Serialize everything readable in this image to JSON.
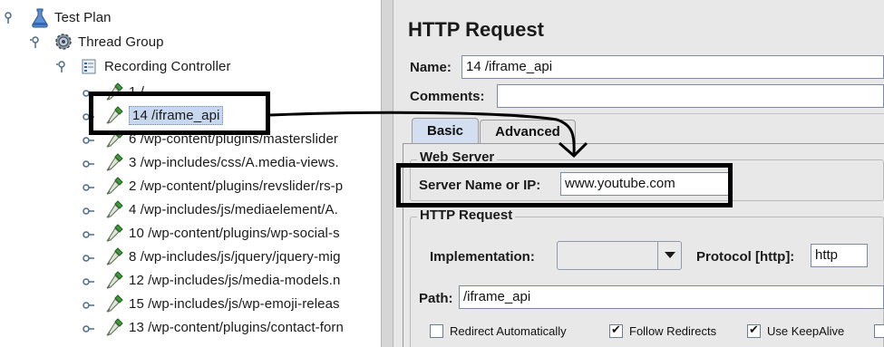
{
  "tree": {
    "test_plan": "Test Plan",
    "thread_group": "Thread Group",
    "recording_controller": "Recording Controller",
    "samplers": [
      "1 /",
      "14 /iframe_api",
      "6 /wp-content/plugins/masterslider",
      "3 /wp-includes/css/A.media-views.",
      "2 /wp-content/plugins/revslider/rs-p",
      "4 /wp-includes/js/mediaelement/A.",
      "10 /wp-content/plugins/wp-social-s",
      "8 /wp-includes/js/jquery/jquery-mig",
      "12 /wp-includes/js/media-models.n",
      "15 /wp-includes/js/wp-emoji-releas",
      "13 /wp-content/plugins/contact-forn"
    ]
  },
  "panel": {
    "title": "HTTP Request",
    "name_label": "Name:",
    "name_value": "14 /iframe_api",
    "comments_label": "Comments:",
    "tabs": [
      "Basic",
      "Advanced"
    ],
    "web_server_group": "Web Server",
    "server_label": "Server Name or IP:",
    "server_value": "www.youtube.com",
    "http_request_group": "HTTP Request",
    "implementation_label": "Implementation:",
    "implementation_value": "",
    "protocol_label": "Protocol [http]:",
    "protocol_value": "http",
    "path_label": "Path:",
    "path_value": "/iframe_api",
    "checkboxes": [
      {
        "label": "Redirect Automatically",
        "checked": false
      },
      {
        "label": "Follow Redirects",
        "checked": true
      },
      {
        "label": "Use KeepAlive",
        "checked": true
      }
    ]
  },
  "icons": {
    "test_plan": "flask-icon",
    "thread_group": "gear-icon",
    "recording_controller": "controller-icon",
    "sampler": "pipette-icon",
    "dropdown": "chevron-down-icon"
  },
  "colors": {
    "selection": "#c7d7ee",
    "panel_bg": "#e8e8e8",
    "tab_active": "#d3def0",
    "annotation": "#000000"
  }
}
